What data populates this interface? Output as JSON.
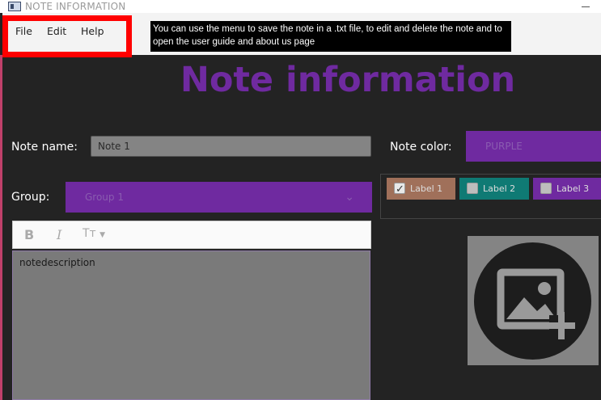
{
  "window": {
    "title": "NOTE INFORMATION"
  },
  "menu": {
    "items": [
      {
        "label": "File"
      },
      {
        "label": "Edit"
      },
      {
        "label": "Help"
      }
    ]
  },
  "callout": {
    "text": "You can use the menu to save the note in a .txt file, to edit and delete the note and to open the user guide and about us page"
  },
  "heading": "Note information",
  "form": {
    "note_name_label": "Note name:",
    "note_name_value": "Note 1",
    "note_color_label": "Note color:",
    "note_color_value": "PURPLE",
    "group_label": "Group:",
    "group_value": "Group 1"
  },
  "labels": [
    {
      "text": "Label 1",
      "checked": true,
      "color": "#a0705a"
    },
    {
      "text": "Label 2",
      "checked": false,
      "color": "#0f7a74"
    },
    {
      "text": "Label 3",
      "checked": false,
      "color": "#6f2aa0"
    }
  ],
  "editor": {
    "bold_label": "B",
    "italic_label": "I",
    "text_size_label": "Tт",
    "content": "notedescription"
  },
  "icons": {
    "app": "window-app-icon",
    "minimize": "minimize-icon",
    "image": "add-image-icon"
  },
  "colors": {
    "accent_purple": "#6f2aa0",
    "background": "#232323",
    "highlight_red": "#ff0000"
  }
}
